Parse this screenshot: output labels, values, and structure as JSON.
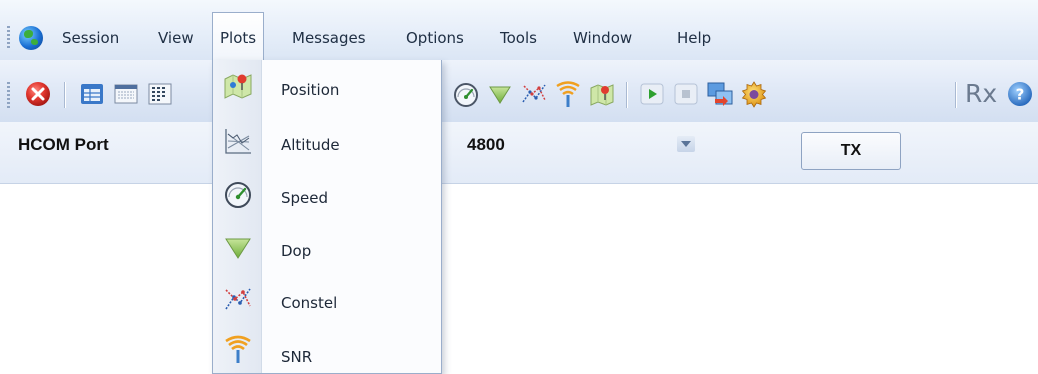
{
  "menubar": {
    "items": [
      {
        "label": "Session"
      },
      {
        "label": "View"
      },
      {
        "label": "Plots"
      },
      {
        "label": "Messages"
      },
      {
        "label": "Options"
      },
      {
        "label": "Tools"
      },
      {
        "label": "Window"
      },
      {
        "label": "Help"
      }
    ],
    "open_menu": "Plots"
  },
  "toolbar": {
    "icons": [
      "close-icon",
      "table-view-icon",
      "grid-view-icon",
      "message-view-icon",
      "speed-gauge-icon",
      "dop-funnel-icon",
      "constellation-icon",
      "snr-antenna-icon",
      "position-map-icon",
      "play-icon",
      "stop-icon",
      "screen-capture-icon",
      "settings-gear-icon",
      "help-icon"
    ],
    "rx_label": "Rx"
  },
  "port": {
    "label": "HCOM Port",
    "baud_value": "4800",
    "tx_label": "TX"
  },
  "plots_menu": {
    "items": [
      {
        "label": "Position",
        "icon": "position-map-icon"
      },
      {
        "label": "Altitude",
        "icon": "altitude-chart-icon"
      },
      {
        "label": "Speed",
        "icon": "speed-gauge-icon"
      },
      {
        "label": "Dop",
        "icon": "dop-funnel-icon"
      },
      {
        "label": "Constel",
        "icon": "constellation-icon"
      },
      {
        "label": "SNR",
        "icon": "snr-antenna-icon"
      }
    ]
  },
  "colors": {
    "menubar_bg": "#e6eef9",
    "toolbar_bg": "#dfe8f6",
    "menu_text": "#203045",
    "accent_red": "#d9322e",
    "accent_green": "#2ea02e",
    "accent_orange": "#f0a020"
  }
}
